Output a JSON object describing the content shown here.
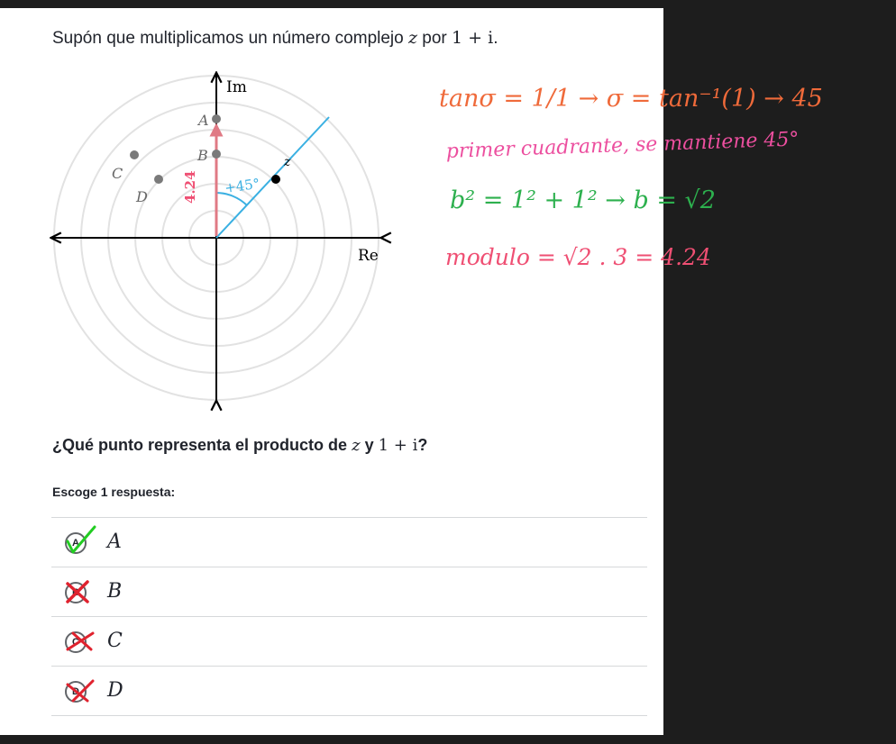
{
  "prompt": {
    "text": "Supón que multiplicamos un número complejo",
    "variable": "z",
    "connector": "por",
    "factor": "1 + i",
    "end": "."
  },
  "plane": {
    "real_axis_label": "Re",
    "imag_axis_label": "Im",
    "points": {
      "a": "A",
      "b": "B",
      "c": "C",
      "d": "D",
      "z": "z"
    },
    "angle_annotation": "+45°",
    "length_annotation": "4.24"
  },
  "notes": {
    "line1": "tanσ = 1/1 → σ = tan⁻¹(1) → 45",
    "line2": "primer cuadrante, se mantiene 45°",
    "line3": "b² = 1² + 1² → b = √2",
    "line4": "modulo = √2 . 3 = 4.24"
  },
  "question": {
    "before": "¿Qué punto representa el producto de",
    "variable": "z",
    "connector": "y",
    "factor": "1 + i",
    "end": "?"
  },
  "instruction": "Escoge 1 respuesta:",
  "choices": [
    {
      "letter": "A",
      "label": "A",
      "status": "selected"
    },
    {
      "letter": "B",
      "label": "B",
      "status": "crossed"
    },
    {
      "letter": "C",
      "label": "C",
      "status": "crossed"
    },
    {
      "letter": "D",
      "label": "D",
      "status": "crossed"
    }
  ],
  "colors": {
    "axis": "#000000",
    "grid": "#e2e2e2",
    "blue": "#3ab0e2",
    "red_vector": "#e07a85",
    "orange": "#ef6a3a",
    "pink": "#ec4f9f",
    "green": "#2db04e",
    "rose": "#ef4f73",
    "check": "#22cc22",
    "cross": "#e0222e"
  }
}
